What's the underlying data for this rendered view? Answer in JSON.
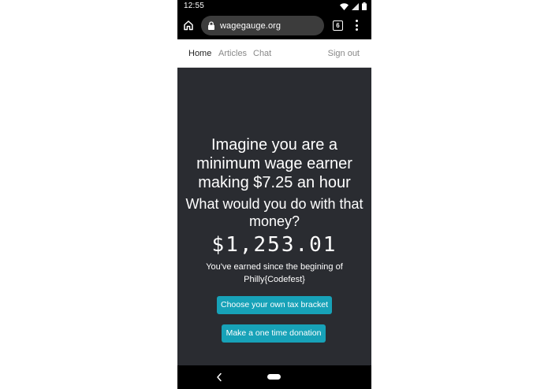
{
  "status_bar": {
    "time": "12:55"
  },
  "browser": {
    "url": "wagegauge.org",
    "tab_count": "6"
  },
  "nav": {
    "items": [
      {
        "label": "Home",
        "active": true
      },
      {
        "label": "Articles",
        "active": false
      },
      {
        "label": "Chat",
        "active": false
      }
    ],
    "sign_out": "Sign out"
  },
  "hero": {
    "headline": "Imagine you are a minimum wage earner making $7.25 an hour",
    "subheadline": "What would you do with that money?",
    "earned_amount": "$1,253.01",
    "caption": "You've earned since the begining of Philly{Codefest}",
    "tax_button": "Choose your own tax bracket",
    "donate_button": "Make a one time donation"
  },
  "colors": {
    "hero_background": "#2a2c31",
    "button_accent": "#17a2b8",
    "system_bar": "#000000"
  },
  "icons": {
    "home": "home-icon",
    "lock": "lock-icon",
    "menu": "more-vert-icon",
    "back": "back-arrow-icon",
    "wifi": "wifi-icon",
    "signal": "signal-icon",
    "battery": "battery-icon"
  }
}
